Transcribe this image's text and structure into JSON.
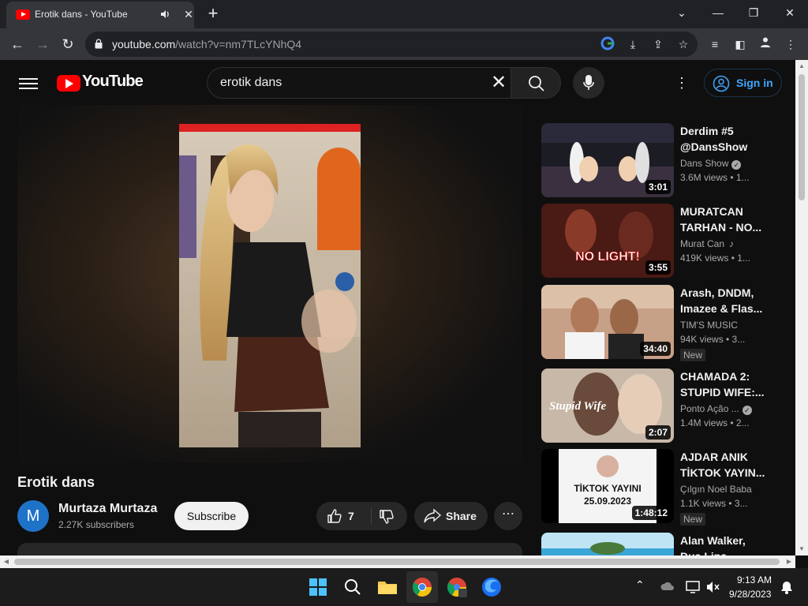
{
  "browser": {
    "tab_title": "Erotik dans - YouTube",
    "url_host": "youtube.com",
    "url_path": "/watch?v=nm7TLcYNhQ4"
  },
  "youtube": {
    "logo_text": "YouTube",
    "search_value": "erotik dans",
    "signin_label": "Sign in"
  },
  "video": {
    "title": "Erotik dans",
    "channel_initial": "M",
    "channel_name": "Murtaza Murtaza",
    "subscribers": "2.27K subscribers",
    "subscribe_label": "Subscribe",
    "like_count": "7",
    "share_label": "Share"
  },
  "recommendations": [
    {
      "title": "Derdim #5 @DansShow",
      "channel": "Dans Show",
      "verified": true,
      "views": "3.6M views • 1...",
      "duration": "3:01",
      "badge": ""
    },
    {
      "title": "MURATCAN TARHAN - NO...",
      "channel": "Murat Can",
      "music": true,
      "views": "419K views • 1...",
      "duration": "3:55",
      "badge": "",
      "thumb_text": "NO LIGHT!"
    },
    {
      "title": "Arash, DNDM, Imazee & Flas...",
      "channel": "TIM'S MUSIC",
      "views": "94K views • 3...",
      "duration": "34:40",
      "badge": "New"
    },
    {
      "title": "CHAMADA 2: STUPID WIFE:...",
      "channel": "Ponto Ação ...",
      "verified": true,
      "views": "1.4M views • 2...",
      "duration": "2:07",
      "badge": "",
      "thumb_text": "Stupid Wife"
    },
    {
      "title": "AJDAR ANIK TİKTOK YAYIN...",
      "channel": "Çılgın Noel Baba",
      "views": "1.1K views • 3...",
      "duration": "1:48:12",
      "badge": "New",
      "thumb_text": "TİKTOK YAYINI\n25.09.2023"
    },
    {
      "title": "Alan Walker, Dua Lipa...",
      "channel": "",
      "views": "",
      "duration": "",
      "badge": ""
    }
  ],
  "taskbar": {
    "time": "9:13 AM",
    "date": "9/28/2023"
  },
  "colors": {
    "yt_red": "#ff0000",
    "link_blue": "#3ea6ff",
    "bg": "#0f0f0f"
  }
}
